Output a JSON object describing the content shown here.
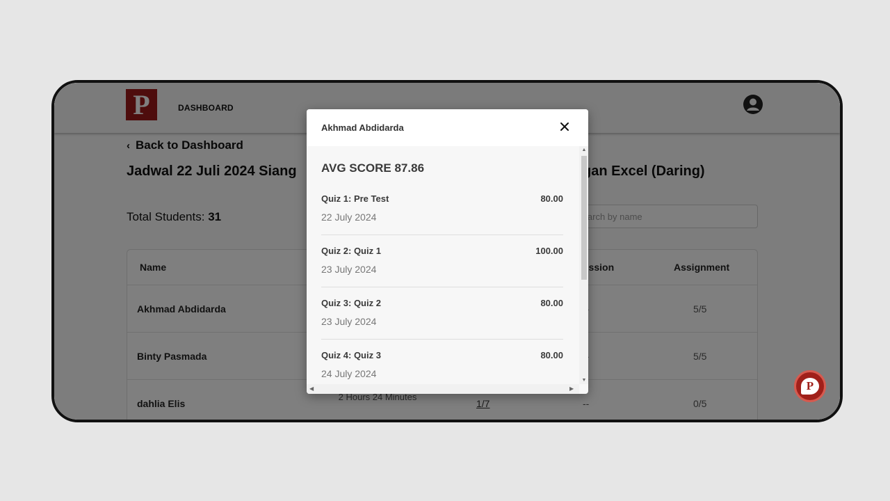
{
  "header": {
    "logo_letter": "P",
    "nav_label": "DASHBOARD",
    "avatar_icon": "user-circle-icon"
  },
  "page": {
    "back_label": "Back to Dashboard",
    "title_left": "Jadwal 22 Juli 2024 Siang",
    "title_right": "gan Excel (Daring)",
    "total_label": "Total Students:",
    "total_value": "31",
    "search_placeholder": "Search by name"
  },
  "table": {
    "headers": {
      "name": "Name",
      "discussion": "ussion",
      "assignment": "Assignment"
    },
    "rows": [
      {
        "name": "Akhmad Abdidarda",
        "discussion": "--",
        "assignment": "5/5"
      },
      {
        "name": "Binty Pasmada",
        "discussion": "--",
        "assignment": "5/5"
      },
      {
        "name": "dahlia Elis",
        "time": "2 Hours 24 Minutes",
        "quiz": "1/7",
        "discussion": "--",
        "assignment": "0/5"
      }
    ]
  },
  "modal": {
    "title": "Akhmad Abdidarda",
    "avg_score": "AVG SCORE 87.86",
    "quizzes": [
      {
        "title": "Quiz 1: Pre Test",
        "score": "80.00",
        "date": "22 July 2024"
      },
      {
        "title": "Quiz 2: Quiz 1",
        "score": "100.00",
        "date": "23 July 2024"
      },
      {
        "title": "Quiz 3: Quiz 2",
        "score": "80.00",
        "date": "23 July 2024"
      },
      {
        "title": "Quiz 4: Quiz 3",
        "score": "80.00",
        "date": "24 July 2024"
      }
    ]
  },
  "colors": {
    "brand": "#9c1b1b",
    "overlay": "rgba(0,0,0,0.5)",
    "background": "#e6e6e6"
  }
}
